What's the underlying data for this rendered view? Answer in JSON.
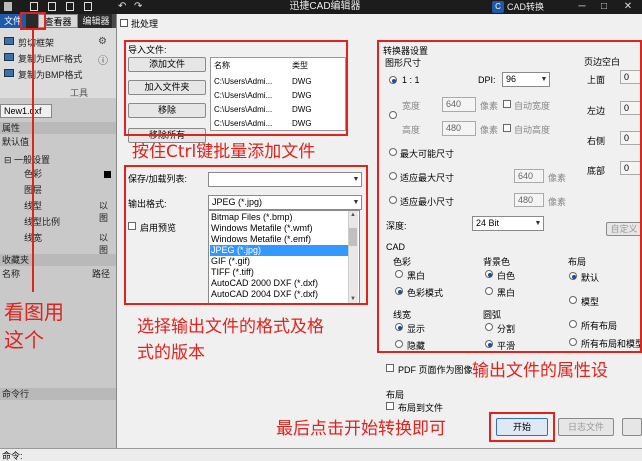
{
  "titlebar": {
    "app_title": "迅捷CAD编辑器",
    "cad_badge": "C",
    "cad_convert": "CAD转换",
    "min": "─",
    "max": "□",
    "close": "✕"
  },
  "ribbon": {
    "tabs": {
      "file": "文件",
      "viewer": "查看器",
      "editor": "编辑器"
    },
    "items": [
      "剪切框架",
      "复制为EMF格式",
      "复制为BMP格式"
    ],
    "tools_label": "工具"
  },
  "left": {
    "doc_tab": "New1.dxf",
    "properties_header": "属性",
    "default_value": "默认值",
    "general_settings": "一般设置",
    "props": [
      "色彩",
      "图层",
      "线型",
      "线型比例",
      "线宽"
    ],
    "prop_values": [
      "",
      "",
      "以图",
      "",
      "以图"
    ],
    "favorites": "收藏夹",
    "col_name": "名称",
    "col_path": "路径",
    "command_line": "命令行",
    "command_label": "命令:"
  },
  "dialog": {
    "title": "批处理",
    "import_label": "导入文件:",
    "buttons": {
      "add_file": "添加文件",
      "add_folder": "加入文件夹",
      "remove": "移除",
      "remove_all": "移除所有"
    },
    "file_cols": {
      "name": "名称",
      "type": "类型"
    },
    "files": [
      {
        "name": "C:\\Users\\Admi...",
        "type": "DWG"
      },
      {
        "name": "C:\\Users\\Admi...",
        "type": "DWG"
      },
      {
        "name": "C:\\Users\\Admi...",
        "type": "DWG"
      },
      {
        "name": "C:\\Users\\Admi...",
        "type": "DWG"
      }
    ],
    "save_load_label": "保存/加载列表:",
    "output_format_label": "输出格式:",
    "output_format_value": "JPEG (*.jpg)",
    "enable_preview": "启用预览",
    "format_options": [
      "Bitmap Files (*.bmp)",
      "Windows Metafile (*.wmf)",
      "Windows Metafile (*.emf)",
      "JPEG (*.jpg)",
      "GIF (*.gif)",
      "TIFF (*.tiff)",
      "AutoCAD 2000 DXF (*.dxf)",
      "AutoCAD 2004 DXF (*.dxf)"
    ],
    "selected_format_index": 3,
    "converter": {
      "title": "转换器设置",
      "graphic_size": "图形尺寸",
      "ratio": "1 : 1",
      "dpi_label": "DPI:",
      "dpi_value": "96",
      "width_label": "宽度",
      "width_value": "640",
      "height_label": "高度",
      "height_value": "480",
      "px": "像素",
      "auto_width": "自动宽度",
      "auto_height": "自动高度",
      "max_size": "最大可能尺寸",
      "fit_max": "适应最大尺寸",
      "fit_min": "适应最小尺寸",
      "fit_max_value": "640",
      "fit_min_value": "480",
      "depth_label": "深度:",
      "depth_value": "24 Bit",
      "cad_label": "CAD",
      "color_label": "色彩",
      "color_bw": "黑白",
      "color_mode": "色彩模式",
      "bg_label": "背景色",
      "bg_white": "白色",
      "bg_black": "黑白",
      "layout_label": "布局",
      "layout_default": "默认",
      "layout_model": "模型",
      "layout_all": "所有布局",
      "layout_all_model": "所有布局和模型",
      "linewidth_label": "线宽",
      "lw_show": "显示",
      "lw_hide": "隐藏",
      "arc_label": "圆弧",
      "arc_split": "分割",
      "arc_smooth": "平滑"
    },
    "margins": {
      "title": "页边空白",
      "top": "上面",
      "left": "左边",
      "right": "右侧",
      "bottom": "底部",
      "value": "0",
      "custom": "自定义"
    },
    "pdf_label": "PDF 页面作为图像",
    "layout2_label": "布局",
    "layout_to_file": "布局到文件",
    "start_button": "开始",
    "log_button": "日志文件"
  },
  "annotations": {
    "ctrl_batch": "按住Ctrl键批量添加文件",
    "select_format": "选择输出文件的格式及格",
    "select_format_2": "式的版本",
    "output_props": "输出文件的属性设",
    "click_start": "最后点击开始转换即可",
    "look_at_pic": "看图用",
    "look_at_pic_2": "这个"
  }
}
